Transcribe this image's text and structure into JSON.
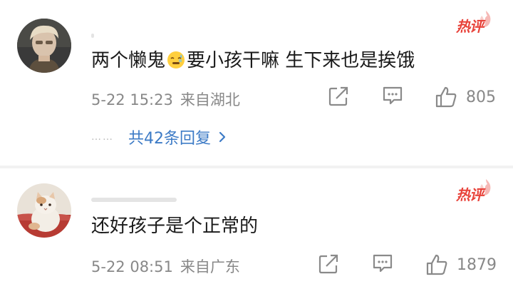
{
  "comments": [
    {
      "text_parts": [
        "两个懒鬼",
        "要小孩干嘛 生下来也是挨饿"
      ],
      "emoji": "sweat-face-icon",
      "hot_label": "热评",
      "date": "5-22 15:23",
      "location": "来自湖北",
      "likes": "805",
      "thread_dots": "……",
      "replies_label": "共42条回复"
    },
    {
      "text": "还好孩子是个正常的",
      "hot_label": "热评",
      "date": "5-22 08:51",
      "location": "来自广东",
      "likes": "1879"
    }
  ],
  "colors": {
    "hot": "#e8423a",
    "link": "#3d7bc6",
    "meta": "#888888",
    "text": "#1a1a1a"
  }
}
